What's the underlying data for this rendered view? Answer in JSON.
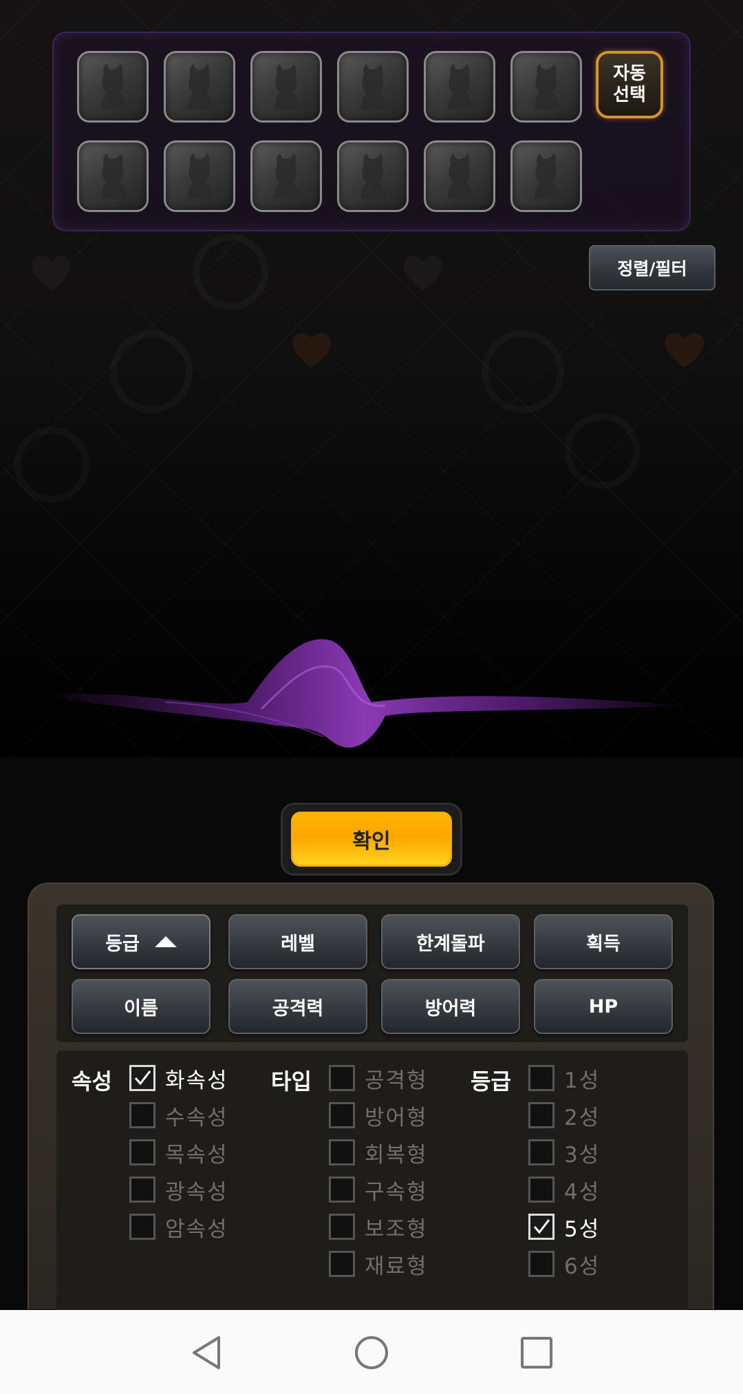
{
  "slots": {
    "row1": [
      "",
      "",
      "",
      "",
      "",
      ""
    ],
    "row2": [
      "",
      "",
      "",
      "",
      "",
      ""
    ],
    "auto_select_line1": "자동",
    "auto_select_line2": "선택"
  },
  "sort_filter_label": "정렬/필터",
  "confirm_label": "확인",
  "sort_options": [
    {
      "label": "등급",
      "active": true,
      "direction": "ascending"
    },
    {
      "label": "레벨"
    },
    {
      "label": "한계돌파"
    },
    {
      "label": "획득"
    },
    {
      "label": "이름"
    },
    {
      "label": "공격력"
    },
    {
      "label": "방어력"
    },
    {
      "label": "HP"
    }
  ],
  "filters": {
    "attribute": {
      "title": "속성",
      "options": [
        {
          "label": "화속성",
          "checked": true
        },
        {
          "label": "수속성",
          "checked": false
        },
        {
          "label": "목속성",
          "checked": false
        },
        {
          "label": "광속성",
          "checked": false
        },
        {
          "label": "암속성",
          "checked": false
        }
      ]
    },
    "type": {
      "title": "타입",
      "options": [
        {
          "label": "공격형",
          "checked": false
        },
        {
          "label": "방어형",
          "checked": false
        },
        {
          "label": "회복형",
          "checked": false
        },
        {
          "label": "구속형",
          "checked": false
        },
        {
          "label": "보조형",
          "checked": false
        },
        {
          "label": "재료형",
          "checked": false
        }
      ]
    },
    "grade": {
      "title": "등급",
      "options": [
        {
          "label": "1성",
          "checked": false
        },
        {
          "label": "2성",
          "checked": false
        },
        {
          "label": "3성",
          "checked": false
        },
        {
          "label": "4성",
          "checked": false
        },
        {
          "label": "5성",
          "checked": true
        },
        {
          "label": "6성",
          "checked": false
        }
      ]
    }
  },
  "colors": {
    "accent_orange": "#ffa600",
    "panel_purple": "#3d2456",
    "smoke_purple": "#7a2aa8"
  },
  "icons": {
    "slot": "character-silhouette-icon",
    "sort_direction": "triangle-up-icon",
    "check": "checkmark-icon",
    "nav_back": "back-triangle-icon",
    "nav_home": "home-circle-icon",
    "nav_recents": "recents-square-icon"
  }
}
